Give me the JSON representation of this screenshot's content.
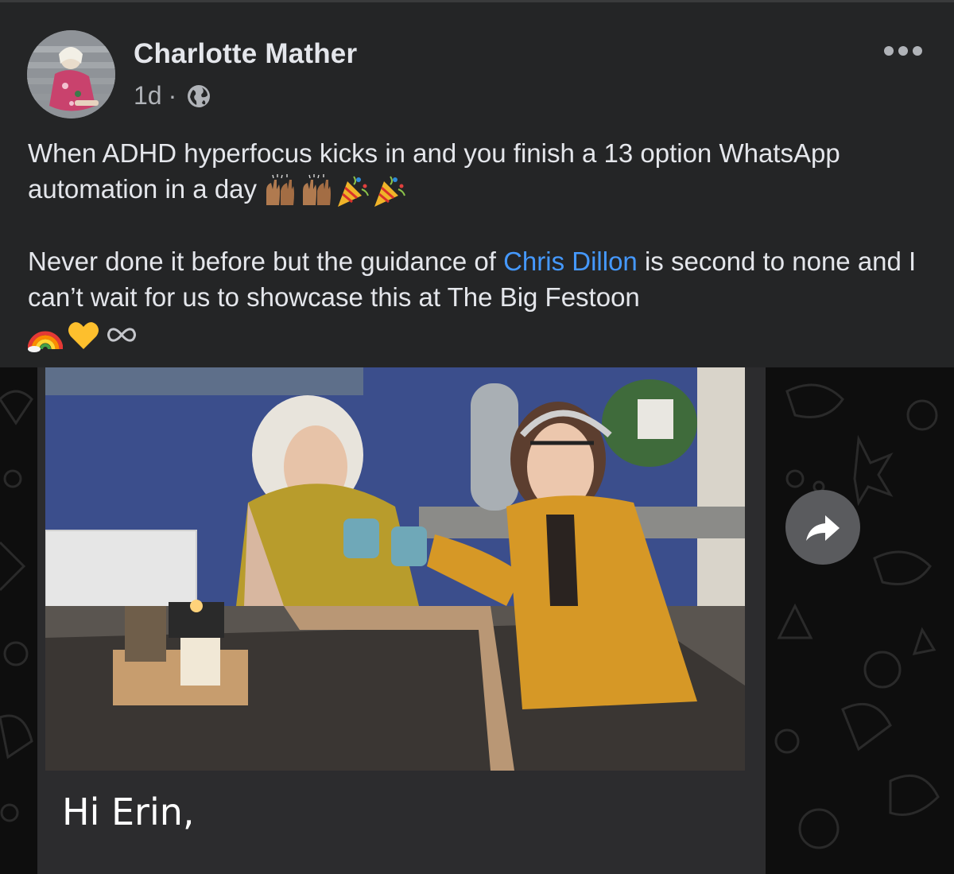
{
  "post": {
    "author": "Charlotte Mather",
    "time": "1d",
    "separator": "·",
    "audience_icon": "globe-icon",
    "more_icon": "more-options-icon",
    "text_line1": "When ADHD hyperfocus kicks in and you finish a 13 option WhatsApp automation in a day",
    "text_line2_prefix": "Never done it before but the guidance of ",
    "mention": "Chris Dillon",
    "text_line2_suffix": " is second to none and I can’t wait for us to showcase this at The Big Festoon",
    "emojis_line1": [
      "raising-hands-emoji",
      "raising-hands-emoji",
      "party-popper-emoji",
      "party-popper-emoji"
    ],
    "emojis_line2": [
      "rainbow-emoji",
      "yellow-heart-emoji",
      "infinity-emoji"
    ]
  },
  "media": {
    "greeting": "Hi Erin,",
    "share_icon": "share-arrow-icon"
  },
  "colors": {
    "background": "#242526",
    "text": "#e4e6eb",
    "secondary_text": "#b0b3b8",
    "mention": "#4599ff"
  }
}
